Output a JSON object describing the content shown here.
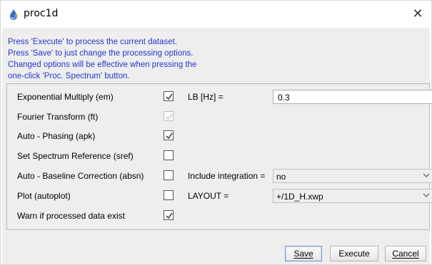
{
  "window": {
    "title": "proc1d"
  },
  "info_lines": [
    "Press 'Execute' to process the current dataset.",
    "Press 'Save' to just change the processing options.",
    "Changed options will be effective when pressing the",
    "one-click 'Proc. Spectrum' button."
  ],
  "options": [
    {
      "label": "Exponential Multiply (em)",
      "checked": true,
      "enabled": true
    },
    {
      "label": "Fourier Transform (ft)",
      "checked": true,
      "enabled": false
    },
    {
      "label": "Auto - Phasing (apk)",
      "checked": true,
      "enabled": true
    },
    {
      "label": "Set Spectrum Reference (sref)",
      "checked": false,
      "enabled": true
    },
    {
      "label": "Auto - Baseline Correction (absn)",
      "checked": false,
      "enabled": true
    },
    {
      "label": "Plot (autoplot)",
      "checked": false,
      "enabled": true
    },
    {
      "label": "Warn if processed data exist",
      "checked": true,
      "enabled": true
    }
  ],
  "params": {
    "lb_label": "LB [Hz] =",
    "lb_value": "0.3",
    "integration_label": "Include integration =",
    "integration_value": "no",
    "layout_label": "LAYOUT =",
    "layout_value": "+/1D_H.xwp"
  },
  "buttons": {
    "save": "Save",
    "execute": "Execute",
    "cancel": "Cancel"
  },
  "colors": {
    "info_text": "#2637c8",
    "panel_bg": "#eeeeee",
    "default_button_border": "#7a9ad0"
  },
  "icons": {
    "app": "bruker-drop-icon",
    "close": "close-icon",
    "check": "checkmark-icon",
    "dropdown": "chevron-down-icon"
  }
}
